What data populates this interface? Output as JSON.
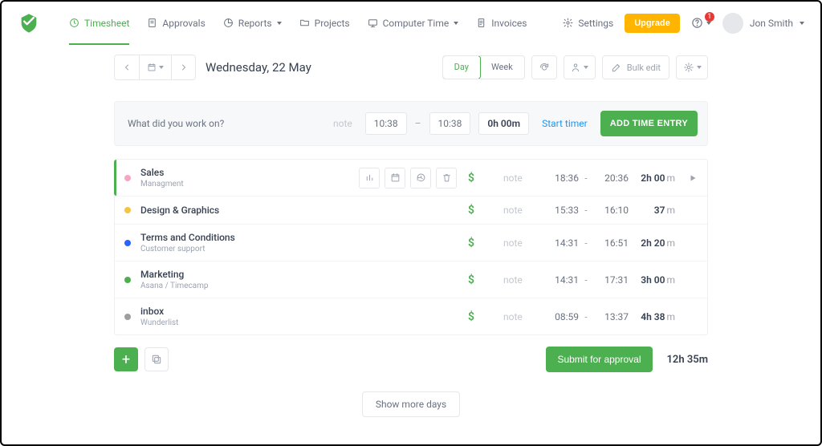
{
  "nav": {
    "timesheet": "Timesheet",
    "approvals": "Approvals",
    "reports": "Reports",
    "projects": "Projects",
    "computer_time": "Computer Time",
    "invoices": "Invoices"
  },
  "header": {
    "settings": "Settings",
    "upgrade": "Upgrade",
    "notif_count": "1",
    "user": "Jon Smith"
  },
  "toolbar": {
    "date": "Wednesday, 22 May",
    "day": "Day",
    "week": "Week",
    "bulk_edit": "Bulk edit"
  },
  "input": {
    "placeholder": "What did you work on?",
    "note": "note",
    "start": "10:38",
    "end": "10:38",
    "dur": "0h 00m",
    "start_timer": "Start timer",
    "add_entry": "ADD TIME ENTRY"
  },
  "entries": [
    {
      "dot": "#f8a5c2",
      "title": "Sales",
      "sub": "Managment",
      "note": "note",
      "start": "18:36",
      "end": "20:36",
      "dur_h": "2h 00",
      "dur_m": "m",
      "play": true,
      "hover": true
    },
    {
      "dot": "#f6c343",
      "title": "Design & Graphics",
      "sub": "",
      "note": "note",
      "start": "15:33",
      "end": "16:10",
      "dur_h": "37",
      "dur_m": "m",
      "play": false,
      "hover": false
    },
    {
      "dot": "#2962ff",
      "title": "Terms and Conditions",
      "sub": "Customer support",
      "note": "note",
      "start": "14:31",
      "end": "16:51",
      "dur_h": "2h 20",
      "dur_m": "m",
      "play": false,
      "hover": false
    },
    {
      "dot": "#4caf50",
      "title": "Marketing",
      "sub": "Asana / Timecamp",
      "note": "note",
      "start": "14:31",
      "end": "17:31",
      "dur_h": "3h 00",
      "dur_m": "m",
      "play": false,
      "hover": false
    },
    {
      "dot": "#9e9e9e",
      "title": "inbox",
      "sub": "Wunderlist",
      "note": "note",
      "start": "08:59",
      "end": "13:37",
      "dur_h": "4h 38",
      "dur_m": "m",
      "play": false,
      "hover": false
    }
  ],
  "footer": {
    "submit": "Submit for approval",
    "total": "12h 35m",
    "show_more": "Show more days"
  }
}
